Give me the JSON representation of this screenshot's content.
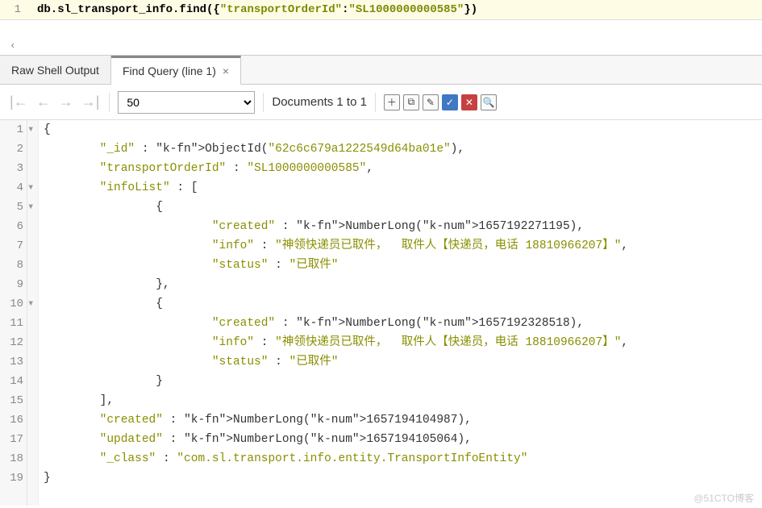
{
  "query": {
    "line": 1,
    "prefix": "db.sl_transport_info.find",
    "open": "({",
    "key": "\"transportOrderId\"",
    "colon": ":",
    "value": "\"SL1000000000585\"",
    "close": "})"
  },
  "tabs": {
    "raw": "Raw Shell Output",
    "find": "Find Query (line 1)"
  },
  "toolbar": {
    "limit": "50",
    "doccount": "Documents 1 to 1"
  },
  "result": {
    "lines": [
      "{",
      "        \"_id\" : ObjectId(\"62c6c679a1222549d64ba01e\"),",
      "        \"transportOrderId\" : \"SL1000000000585\",",
      "        \"infoList\" : [",
      "                {",
      "                        \"created\" : NumberLong(1657192271195),",
      "                        \"info\" : \"神领快递员已取件，  取件人【快递员，电话 18810966207】\",",
      "                        \"status\" : \"已取件\"",
      "                },",
      "                {",
      "                        \"created\" : NumberLong(1657192328518),",
      "                        \"info\" : \"神领快递员已取件，  取件人【快递员，电话 18810966207】\",",
      "                        \"status\" : \"已取件\"",
      "                }",
      "        ],",
      "        \"created\" : NumberLong(1657194104987),",
      "        \"updated\" : NumberLong(1657194105064),",
      "        \"_class\" : \"com.sl.transport.info.entity.TransportInfoEntity\"",
      "}"
    ],
    "doc": {
      "_id_fn": "ObjectId",
      "_id_arg": "62c6c679a1222549d64ba01e",
      "transportOrderId": "SL1000000000585",
      "infoList": [
        {
          "created_fn": "NumberLong",
          "created": 1657192271195,
          "info": "神领快递员已取件，  取件人【快递员，电话 18810966207】",
          "status": "已取件"
        },
        {
          "created_fn": "NumberLong",
          "created": 1657192328518,
          "info": "神领快递员已取件，  取件人【快递员，电话 18810966207】",
          "status": "已取件"
        }
      ],
      "created_fn": "NumberLong",
      "created": 1657194104987,
      "updated_fn": "NumberLong",
      "updated": 1657194105064,
      "_class": "com.sl.transport.info.entity.TransportInfoEntity"
    }
  },
  "watermark": "@51CTO博客"
}
